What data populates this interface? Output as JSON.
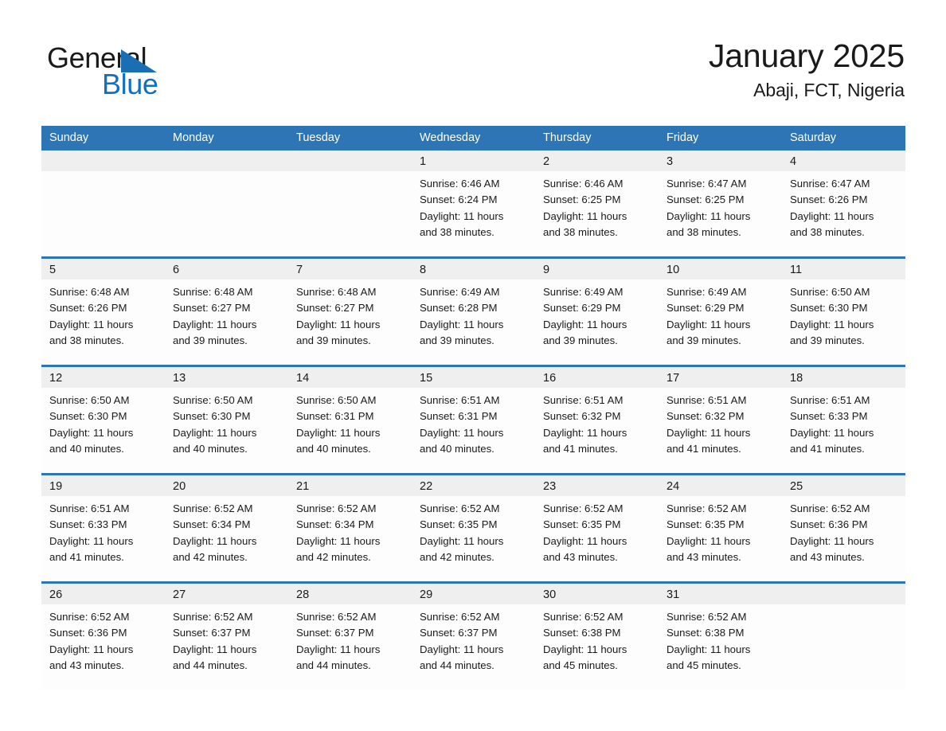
{
  "logo": {
    "word1": "General",
    "word2": "Blue",
    "triangle_color": "#1a6fb4",
    "word2_color": "#1270c0"
  },
  "header": {
    "title": "January 2025",
    "subtitle": "Abaji, FCT, Nigeria"
  },
  "theme": {
    "header_blue": "#2e75b6",
    "daynum_gray": "#efefef",
    "cell_white": "#fdfdfd",
    "text": "#1a1a1a"
  },
  "weekday_headers": [
    "Sunday",
    "Monday",
    "Tuesday",
    "Wednesday",
    "Thursday",
    "Friday",
    "Saturday"
  ],
  "labels": {
    "sunrise_prefix": "Sunrise: ",
    "sunset_prefix": "Sunset: ",
    "daylight_prefix": "Daylight: "
  },
  "weeks": [
    [
      {
        "day": "",
        "empty": true
      },
      {
        "day": "",
        "empty": true
      },
      {
        "day": "",
        "empty": true
      },
      {
        "day": "1",
        "sunrise": "Sunrise: 6:46 AM",
        "sunset": "Sunset: 6:24 PM",
        "daylight_line1": "Daylight: 11 hours",
        "daylight_line2": "and 38 minutes."
      },
      {
        "day": "2",
        "sunrise": "Sunrise: 6:46 AM",
        "sunset": "Sunset: 6:25 PM",
        "daylight_line1": "Daylight: 11 hours",
        "daylight_line2": "and 38 minutes."
      },
      {
        "day": "3",
        "sunrise": "Sunrise: 6:47 AM",
        "sunset": "Sunset: 6:25 PM",
        "daylight_line1": "Daylight: 11 hours",
        "daylight_line2": "and 38 minutes."
      },
      {
        "day": "4",
        "sunrise": "Sunrise: 6:47 AM",
        "sunset": "Sunset: 6:26 PM",
        "daylight_line1": "Daylight: 11 hours",
        "daylight_line2": "and 38 minutes."
      }
    ],
    [
      {
        "day": "5",
        "sunrise": "Sunrise: 6:48 AM",
        "sunset": "Sunset: 6:26 PM",
        "daylight_line1": "Daylight: 11 hours",
        "daylight_line2": "and 38 minutes."
      },
      {
        "day": "6",
        "sunrise": "Sunrise: 6:48 AM",
        "sunset": "Sunset: 6:27 PM",
        "daylight_line1": "Daylight: 11 hours",
        "daylight_line2": "and 39 minutes."
      },
      {
        "day": "7",
        "sunrise": "Sunrise: 6:48 AM",
        "sunset": "Sunset: 6:27 PM",
        "daylight_line1": "Daylight: 11 hours",
        "daylight_line2": "and 39 minutes."
      },
      {
        "day": "8",
        "sunrise": "Sunrise: 6:49 AM",
        "sunset": "Sunset: 6:28 PM",
        "daylight_line1": "Daylight: 11 hours",
        "daylight_line2": "and 39 minutes."
      },
      {
        "day": "9",
        "sunrise": "Sunrise: 6:49 AM",
        "sunset": "Sunset: 6:29 PM",
        "daylight_line1": "Daylight: 11 hours",
        "daylight_line2": "and 39 minutes."
      },
      {
        "day": "10",
        "sunrise": "Sunrise: 6:49 AM",
        "sunset": "Sunset: 6:29 PM",
        "daylight_line1": "Daylight: 11 hours",
        "daylight_line2": "and 39 minutes."
      },
      {
        "day": "11",
        "sunrise": "Sunrise: 6:50 AM",
        "sunset": "Sunset: 6:30 PM",
        "daylight_line1": "Daylight: 11 hours",
        "daylight_line2": "and 39 minutes."
      }
    ],
    [
      {
        "day": "12",
        "sunrise": "Sunrise: 6:50 AM",
        "sunset": "Sunset: 6:30 PM",
        "daylight_line1": "Daylight: 11 hours",
        "daylight_line2": "and 40 minutes."
      },
      {
        "day": "13",
        "sunrise": "Sunrise: 6:50 AM",
        "sunset": "Sunset: 6:30 PM",
        "daylight_line1": "Daylight: 11 hours",
        "daylight_line2": "and 40 minutes."
      },
      {
        "day": "14",
        "sunrise": "Sunrise: 6:50 AM",
        "sunset": "Sunset: 6:31 PM",
        "daylight_line1": "Daylight: 11 hours",
        "daylight_line2": "and 40 minutes."
      },
      {
        "day": "15",
        "sunrise": "Sunrise: 6:51 AM",
        "sunset": "Sunset: 6:31 PM",
        "daylight_line1": "Daylight: 11 hours",
        "daylight_line2": "and 40 minutes."
      },
      {
        "day": "16",
        "sunrise": "Sunrise: 6:51 AM",
        "sunset": "Sunset: 6:32 PM",
        "daylight_line1": "Daylight: 11 hours",
        "daylight_line2": "and 41 minutes."
      },
      {
        "day": "17",
        "sunrise": "Sunrise: 6:51 AM",
        "sunset": "Sunset: 6:32 PM",
        "daylight_line1": "Daylight: 11 hours",
        "daylight_line2": "and 41 minutes."
      },
      {
        "day": "18",
        "sunrise": "Sunrise: 6:51 AM",
        "sunset": "Sunset: 6:33 PM",
        "daylight_line1": "Daylight: 11 hours",
        "daylight_line2": "and 41 minutes."
      }
    ],
    [
      {
        "day": "19",
        "sunrise": "Sunrise: 6:51 AM",
        "sunset": "Sunset: 6:33 PM",
        "daylight_line1": "Daylight: 11 hours",
        "daylight_line2": "and 41 minutes."
      },
      {
        "day": "20",
        "sunrise": "Sunrise: 6:52 AM",
        "sunset": "Sunset: 6:34 PM",
        "daylight_line1": "Daylight: 11 hours",
        "daylight_line2": "and 42 minutes."
      },
      {
        "day": "21",
        "sunrise": "Sunrise: 6:52 AM",
        "sunset": "Sunset: 6:34 PM",
        "daylight_line1": "Daylight: 11 hours",
        "daylight_line2": "and 42 minutes."
      },
      {
        "day": "22",
        "sunrise": "Sunrise: 6:52 AM",
        "sunset": "Sunset: 6:35 PM",
        "daylight_line1": "Daylight: 11 hours",
        "daylight_line2": "and 42 minutes."
      },
      {
        "day": "23",
        "sunrise": "Sunrise: 6:52 AM",
        "sunset": "Sunset: 6:35 PM",
        "daylight_line1": "Daylight: 11 hours",
        "daylight_line2": "and 43 minutes."
      },
      {
        "day": "24",
        "sunrise": "Sunrise: 6:52 AM",
        "sunset": "Sunset: 6:35 PM",
        "daylight_line1": "Daylight: 11 hours",
        "daylight_line2": "and 43 minutes."
      },
      {
        "day": "25",
        "sunrise": "Sunrise: 6:52 AM",
        "sunset": "Sunset: 6:36 PM",
        "daylight_line1": "Daylight: 11 hours",
        "daylight_line2": "and 43 minutes."
      }
    ],
    [
      {
        "day": "26",
        "sunrise": "Sunrise: 6:52 AM",
        "sunset": "Sunset: 6:36 PM",
        "daylight_line1": "Daylight: 11 hours",
        "daylight_line2": "and 43 minutes."
      },
      {
        "day": "27",
        "sunrise": "Sunrise: 6:52 AM",
        "sunset": "Sunset: 6:37 PM",
        "daylight_line1": "Daylight: 11 hours",
        "daylight_line2": "and 44 minutes."
      },
      {
        "day": "28",
        "sunrise": "Sunrise: 6:52 AM",
        "sunset": "Sunset: 6:37 PM",
        "daylight_line1": "Daylight: 11 hours",
        "daylight_line2": "and 44 minutes."
      },
      {
        "day": "29",
        "sunrise": "Sunrise: 6:52 AM",
        "sunset": "Sunset: 6:37 PM",
        "daylight_line1": "Daylight: 11 hours",
        "daylight_line2": "and 44 minutes."
      },
      {
        "day": "30",
        "sunrise": "Sunrise: 6:52 AM",
        "sunset": "Sunset: 6:38 PM",
        "daylight_line1": "Daylight: 11 hours",
        "daylight_line2": "and 45 minutes."
      },
      {
        "day": "31",
        "sunrise": "Sunrise: 6:52 AM",
        "sunset": "Sunset: 6:38 PM",
        "daylight_line1": "Daylight: 11 hours",
        "daylight_line2": "and 45 minutes."
      },
      {
        "day": "",
        "empty": true
      }
    ]
  ]
}
